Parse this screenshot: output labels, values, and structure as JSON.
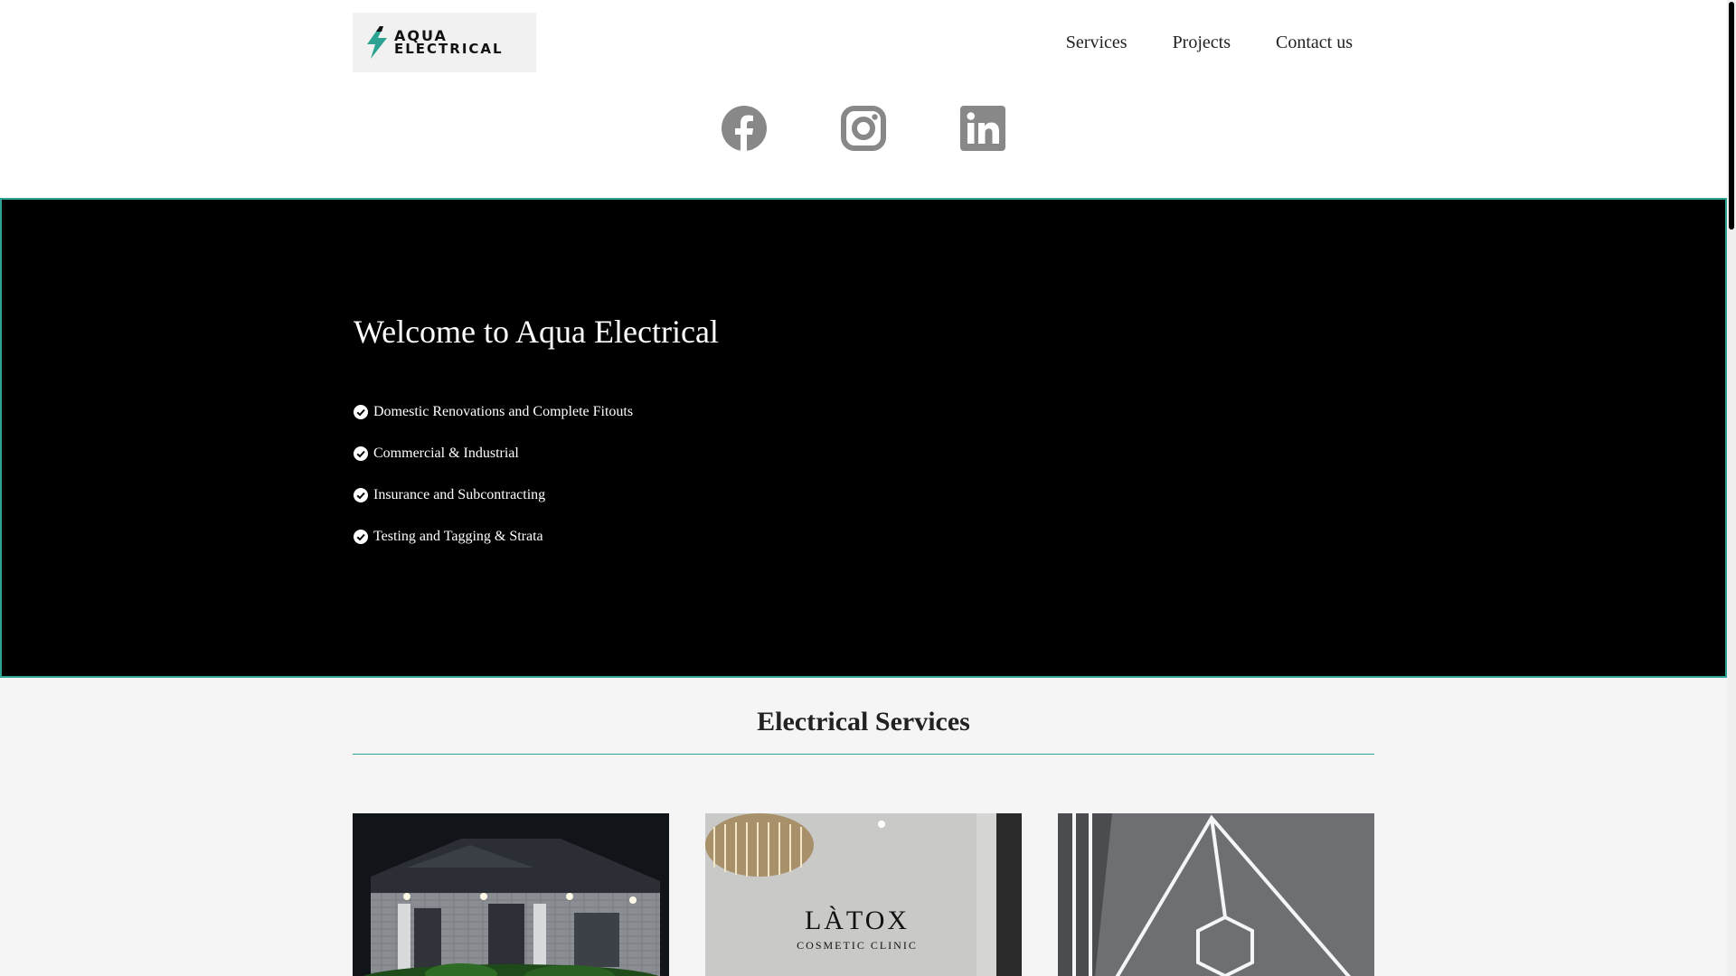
{
  "header": {
    "logo": {
      "line1": "AQUA",
      "line2": "ELECTRICAL",
      "icon": "lightning-bolt-icon",
      "accent": "#2ea394"
    },
    "nav": [
      {
        "label": "Services"
      },
      {
        "label": "Projects"
      },
      {
        "label": "Contact us"
      }
    ],
    "socials": [
      {
        "icon": "facebook-icon"
      },
      {
        "icon": "instagram-icon"
      },
      {
        "icon": "linkedin-icon"
      }
    ],
    "social_color": "#888888"
  },
  "hero": {
    "title": "Welcome to Aqua Electrical",
    "items": [
      "Domestic Renovations and Complete Fitouts",
      "Commercial & Industrial",
      "Insurance and Subcontracting",
      "Testing and Tagging & Strata"
    ],
    "background": "#000000",
    "border_color": "#2ea394"
  },
  "services": {
    "title": "Electrical Services",
    "cards": [
      {
        "image": "house-exterior-night-image"
      },
      {
        "image": "cosmetic-clinic-sign-image",
        "sign_text": "LÀTOX",
        "sign_subtext": "COSMETIC CLINIC"
      },
      {
        "image": "led-ceiling-lights-image"
      }
    ]
  }
}
